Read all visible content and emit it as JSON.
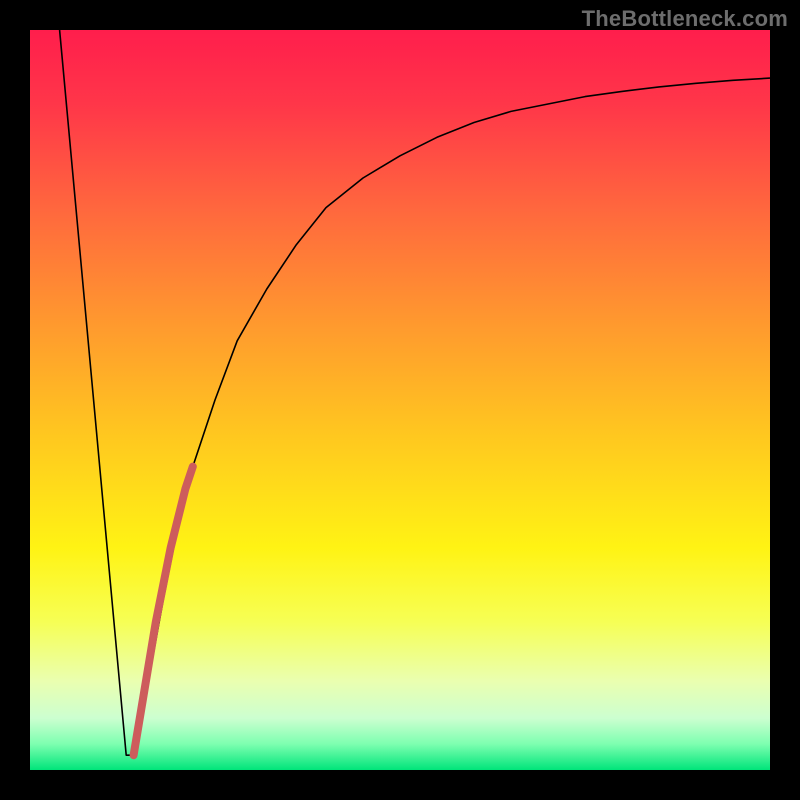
{
  "watermark": "TheBottleneck.com",
  "chart_data": {
    "type": "line",
    "title": "",
    "xlabel": "",
    "ylabel": "",
    "xlim": [
      0,
      100
    ],
    "ylim": [
      0,
      100
    ],
    "grid": false,
    "series": [
      {
        "name": "bottleneck-curve",
        "color": "#000000",
        "width": 1.6,
        "x": [
          4,
          13,
          14,
          16,
          18,
          20,
          22,
          25,
          28,
          32,
          36,
          40,
          45,
          50,
          55,
          60,
          65,
          70,
          75,
          80,
          85,
          90,
          95,
          100
        ],
        "y": [
          100,
          2,
          2,
          12,
          23,
          33,
          41,
          50,
          58,
          65,
          71,
          76,
          80,
          83,
          85.5,
          87.5,
          89,
          90,
          91,
          91.7,
          92.3,
          92.8,
          93.2,
          93.5
        ]
      },
      {
        "name": "highlight-segment",
        "color": "#cd5c5c",
        "width": 8,
        "cap": "round",
        "x": [
          14,
          15,
          16,
          17,
          18,
          19,
          20,
          21,
          22
        ],
        "y": [
          2,
          8,
          14,
          20,
          25,
          30,
          34,
          38,
          41
        ]
      }
    ],
    "background_gradient": {
      "stops": [
        {
          "offset": 0.0,
          "color": "#ff1e4c"
        },
        {
          "offset": 0.1,
          "color": "#ff3649"
        },
        {
          "offset": 0.25,
          "color": "#ff6a3d"
        },
        {
          "offset": 0.4,
          "color": "#ff9a2e"
        },
        {
          "offset": 0.55,
          "color": "#ffc81f"
        },
        {
          "offset": 0.7,
          "color": "#fff314"
        },
        {
          "offset": 0.8,
          "color": "#f6ff55"
        },
        {
          "offset": 0.88,
          "color": "#eaffb0"
        },
        {
          "offset": 0.93,
          "color": "#ccffd0"
        },
        {
          "offset": 0.965,
          "color": "#7dffb0"
        },
        {
          "offset": 1.0,
          "color": "#00e57a"
        }
      ]
    }
  }
}
